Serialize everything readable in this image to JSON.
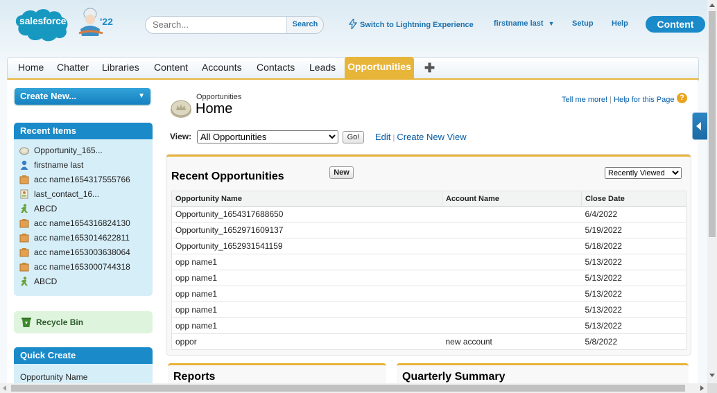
{
  "header": {
    "logo_text": "salesforce",
    "mascot_badge": "'22",
    "search_placeholder": "Search...",
    "search_button": "Search",
    "lightning_link": "Switch to Lightning Experience",
    "user_menu": "firstname last",
    "setup": "Setup",
    "help": "Help",
    "app_button": "Content"
  },
  "tabs": [
    "Home",
    "Chatter",
    "Libraries",
    "Content",
    "Accounts",
    "Contacts",
    "Leads",
    "Opportunities"
  ],
  "active_tab": "Opportunities",
  "sidebar": {
    "create_new": "Create New...",
    "recent_items_title": "Recent Items",
    "recent_items": [
      {
        "label": "Opportunity_165...",
        "icon": "opportunity-coin-icon"
      },
      {
        "label": "firstname last",
        "icon": "user-icon"
      },
      {
        "label": "acc name1654317555766",
        "icon": "account-icon"
      },
      {
        "label": "last_contact_16...",
        "icon": "contact-card-icon"
      },
      {
        "label": "ABCD",
        "icon": "lead-person-icon"
      },
      {
        "label": "acc name1654316824130",
        "icon": "account-icon"
      },
      {
        "label": "acc name1653014622811",
        "icon": "account-icon"
      },
      {
        "label": "acc name1653003638064",
        "icon": "account-icon"
      },
      {
        "label": "acc name1653000744318",
        "icon": "account-icon"
      },
      {
        "label": "ABCD",
        "icon": "lead-person-icon"
      }
    ],
    "recycle_bin": "Recycle Bin",
    "quick_create_title": "Quick Create",
    "quick_create_first_field": "Opportunity Name"
  },
  "page": {
    "subtitle": "Opportunities",
    "title": "Home",
    "tell_me_more": "Tell me more!",
    "help_page": "Help for this Page",
    "view_label": "View:",
    "view_selected": "All Opportunities",
    "go_button": "Go!",
    "edit_link": "Edit",
    "create_view_link": "Create New View"
  },
  "recent_opps": {
    "title": "Recent Opportunities",
    "new_button": "New",
    "sort_selected": "Recently Viewed",
    "columns": [
      "Opportunity Name",
      "Account Name",
      "Close Date"
    ],
    "rows": [
      {
        "name": "Opportunity_1654317688650",
        "account": "",
        "close": "6/4/2022"
      },
      {
        "name": "Opportunity_1652971609137",
        "account": "",
        "close": "5/19/2022"
      },
      {
        "name": "Opportunity_1652931541159",
        "account": "",
        "close": "5/18/2022"
      },
      {
        "name": "opp name1",
        "account": "",
        "close": "5/13/2022"
      },
      {
        "name": "opp name1",
        "account": "",
        "close": "5/13/2022"
      },
      {
        "name": "opp name1",
        "account": "",
        "close": "5/13/2022"
      },
      {
        "name": "opp name1",
        "account": "",
        "close": "5/13/2022"
      },
      {
        "name": "opp name1",
        "account": "",
        "close": "5/13/2022"
      },
      {
        "name": "oppor",
        "account": "new account",
        "close": "5/8/2022"
      }
    ]
  },
  "bottom_sections": {
    "reports": "Reports",
    "quarterly_summary": "Quarterly Summary"
  },
  "colors": {
    "brand_blue": "#1a8ac9",
    "tab_active": "#e8b53b",
    "link": "#015ba7"
  }
}
